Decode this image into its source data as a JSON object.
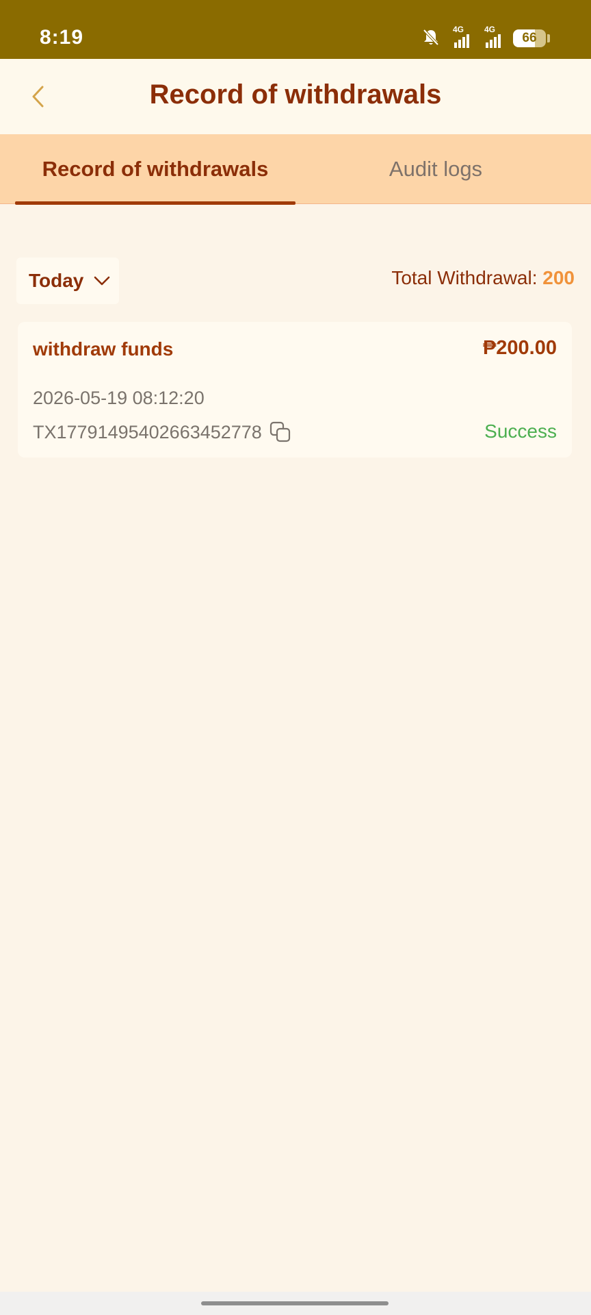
{
  "status_bar": {
    "time": "8:19",
    "signal1_label": "4G",
    "signal2_label": "4G",
    "battery_percent": "66",
    "battery_level": 0.66
  },
  "header": {
    "title": "Record of withdrawals"
  },
  "tabs": [
    {
      "label": "Record of withdrawals",
      "active": true
    },
    {
      "label": "Audit logs",
      "active": false
    }
  ],
  "filter": {
    "selected": "Today"
  },
  "summary": {
    "total_label": "Total Withdrawal:",
    "total_value": "200"
  },
  "records": [
    {
      "title": "withdraw funds",
      "amount": "₱200.00",
      "datetime": "2026-05-19 08:12:20",
      "tx_id": "TX17791495402663452778",
      "status": "Success"
    }
  ],
  "colors": {
    "status_bar": "#8a6b00",
    "brand_text": "#8b2e08",
    "tab_bar": "#fdd5a8",
    "total_accent": "#f0923a",
    "success": "#4caf50",
    "page_bg": "#fcf4e8"
  }
}
